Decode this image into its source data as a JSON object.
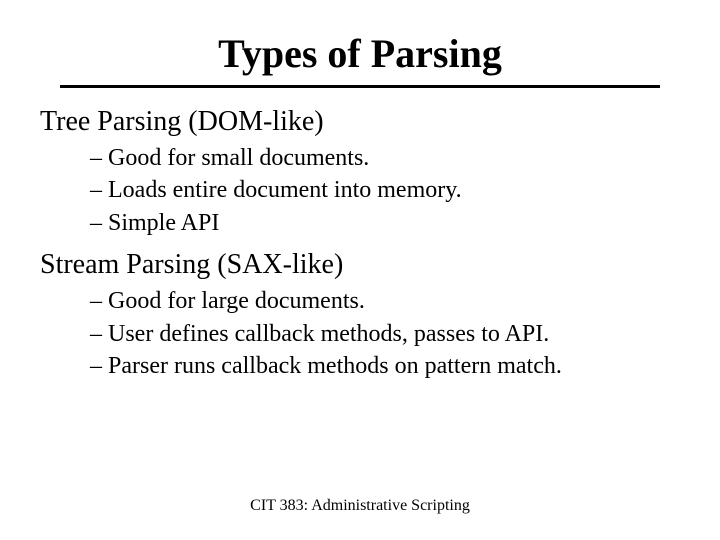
{
  "title": "Types of Parsing",
  "sections": [
    {
      "heading": "Tree Parsing (DOM-like)",
      "bullets": [
        "– Good for small documents.",
        "– Loads entire document into memory.",
        "– Simple API"
      ]
    },
    {
      "heading": "Stream Parsing (SAX-like)",
      "bullets": [
        "– Good for large documents.",
        "– User defines callback methods, passes to API.",
        "– Parser runs callback methods on pattern match."
      ]
    }
  ],
  "footer": "CIT 383: Administrative Scripting"
}
